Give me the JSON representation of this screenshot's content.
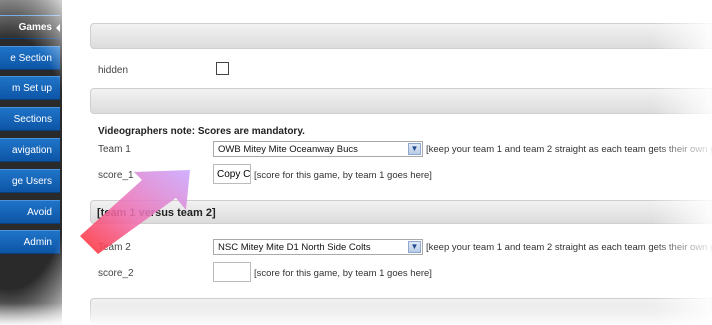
{
  "sidebar": {
    "items": [
      {
        "label": "Games",
        "active": true
      },
      {
        "label": "e Section"
      },
      {
        "label": "m Set up"
      },
      {
        "label": "Sections"
      },
      {
        "label": "avigation"
      },
      {
        "label": "ge Users"
      },
      {
        "label": "Avoid"
      },
      {
        "label": "Admin"
      }
    ]
  },
  "form": {
    "hidden_label": "hidden",
    "hidden_checked": false,
    "note": "Videographers note: Scores are mandatory.",
    "team1_label": "Team 1",
    "team1_value": "OWB Mitey Mite Oceanway Bucs",
    "team1_hint": "[keep your team 1 and team 2 straight as each team gets their own g",
    "score1_label": "score_1",
    "score1_value": "Copy C",
    "score1_hint": "[score for this game, by team 1 goes here]",
    "section_title": "[team 1 versus team 2]",
    "team2_label": "Team 2",
    "team2_value": "NSC Mitey Mite D1 North Side Colts",
    "team2_hint": "[keep your team 1 and team 2 straight as each team gets their own g",
    "score2_label": "score_2",
    "score2_value": "",
    "score2_hint": "[score for this game, by team 1 goes here]"
  },
  "icons": {
    "dropdown": "chevron-down-icon",
    "arrow": "drag-arrow-icon"
  }
}
